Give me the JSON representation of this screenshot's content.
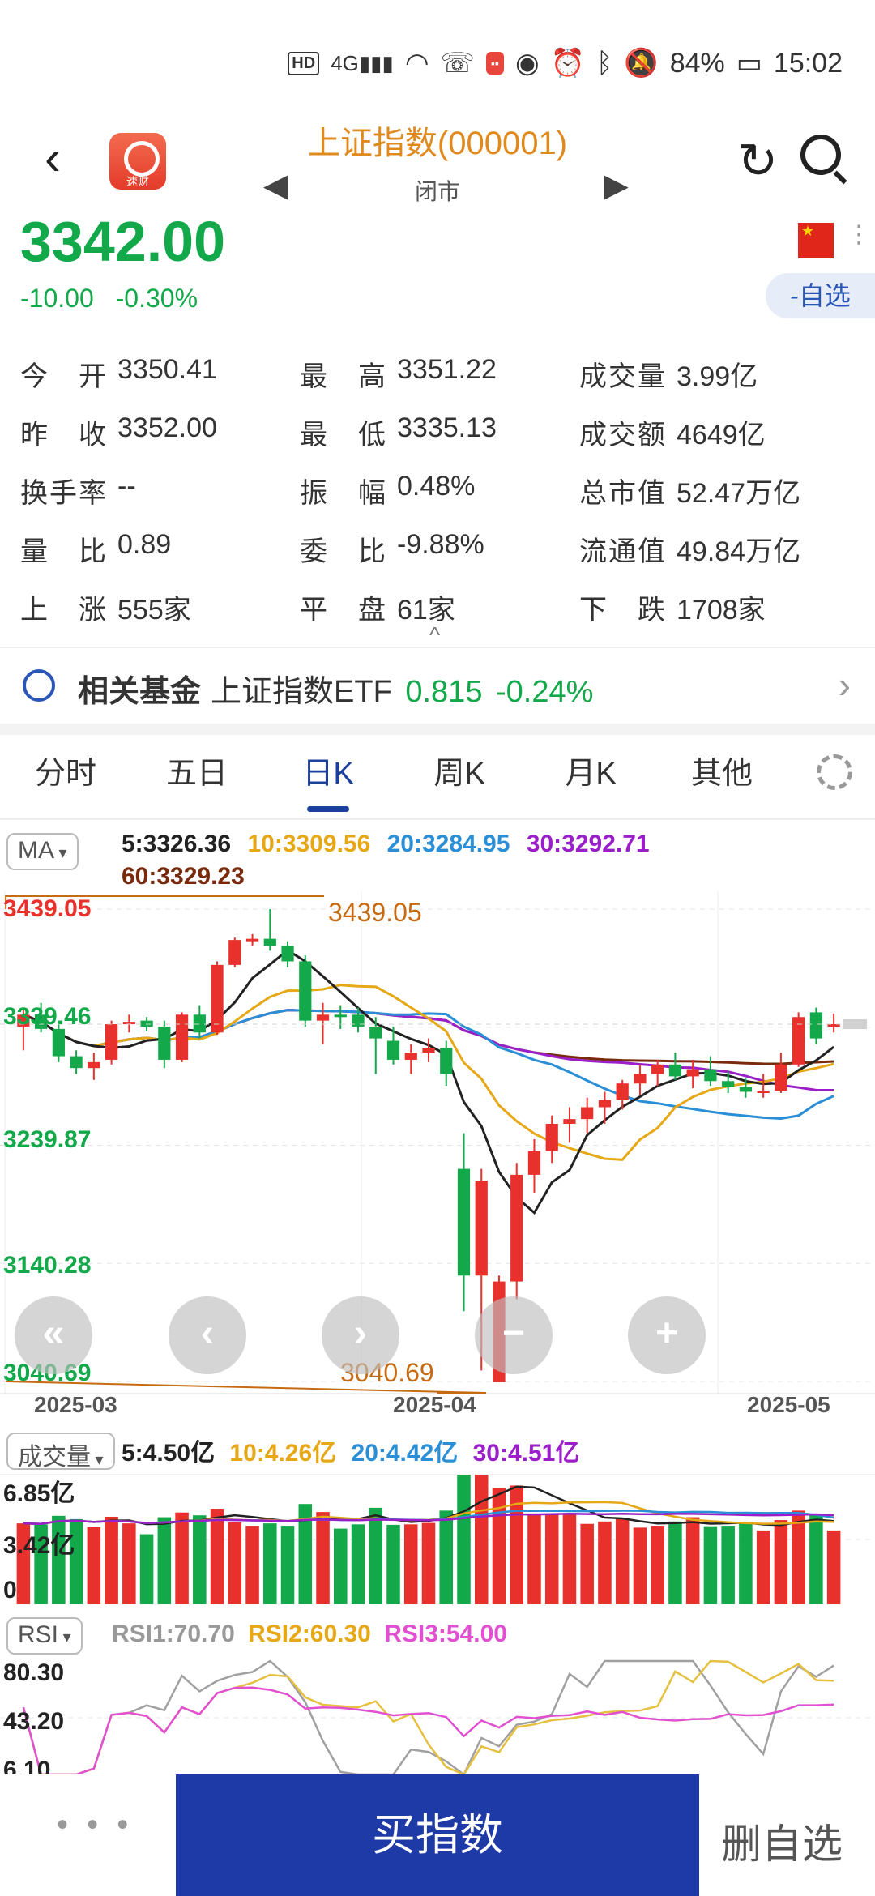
{
  "status_bar": {
    "battery": "84%",
    "time": "15:02",
    "signal": "4G",
    "hd": "HD"
  },
  "header": {
    "title": "上证指数(000001)",
    "market_status": "闭市"
  },
  "quote": {
    "price": "3342.00",
    "change": "-10.00",
    "change_pct": "-0.30%",
    "watch_button": "-自选"
  },
  "stats": [
    [
      {
        "label": "今　开",
        "value": "3350.41"
      },
      {
        "label": "最　高",
        "value": "3351.22"
      },
      {
        "label": "成交量",
        "value": "3.99亿"
      }
    ],
    [
      {
        "label": "昨　收",
        "value": "3352.00"
      },
      {
        "label": "最　低",
        "value": "3335.13"
      },
      {
        "label": "成交额",
        "value": "4649亿"
      }
    ],
    [
      {
        "label": "换手率",
        "value": "--"
      },
      {
        "label": "振　幅",
        "value": "0.48%"
      },
      {
        "label": "总市值",
        "value": "52.47万亿"
      }
    ],
    [
      {
        "label": "量　比",
        "value": "0.89"
      },
      {
        "label": "委　比",
        "value": "-9.88%"
      },
      {
        "label": "流通值",
        "value": "49.84万亿"
      }
    ],
    [
      {
        "label": "上　涨",
        "value": "555家"
      },
      {
        "label": "平　盘",
        "value": "61家"
      },
      {
        "label": "下　跌",
        "value": "1708家"
      }
    ]
  ],
  "fund": {
    "title": "相关基金",
    "name": "上证指数ETF",
    "price": "0.815",
    "change": "-0.24%"
  },
  "tabs": [
    "分时",
    "五日",
    "日K",
    "周K",
    "月K",
    "其他"
  ],
  "active_tab": "日K",
  "ma": {
    "selector": "MA",
    "ma5": "5:3326.36",
    "ma10": "10:3309.56",
    "ma20": "20:3284.95",
    "ma30": "30:3292.71",
    "ma60": "60:3329.23"
  },
  "kline": {
    "y_labels": [
      "3439.05",
      "3339.46",
      "3239.87",
      "3140.28",
      "3040.69"
    ],
    "high_marker": "3439.05",
    "low_marker": "3040.69",
    "x_labels": [
      "2025-03",
      "2025-04",
      "2025-05"
    ]
  },
  "volume": {
    "selector": "成交量",
    "ma5": "5:4.50亿",
    "ma10": "10:4.26亿",
    "ma20": "20:4.42亿",
    "ma30": "30:4.51亿",
    "y_labels": [
      "6.85亿",
      "3.42亿",
      "0"
    ]
  },
  "rsi": {
    "selector": "RSI",
    "rsi1": "RSI1:70.70",
    "rsi2": "RSI2:60.30",
    "rsi3": "RSI3:54.00",
    "y_labels": [
      "80.30",
      "43.20",
      "6.10"
    ]
  },
  "zoom": {
    "back": "«",
    "prev": "‹",
    "next": "›",
    "minus": "−",
    "plus": "+"
  },
  "bottom": {
    "more": "• • •",
    "buy": "买指数",
    "remove": "删自选"
  },
  "colors": {
    "up": "#e8302c",
    "down": "#13a84a",
    "ma5": "#222222",
    "ma10": "#e6a817",
    "ma20": "#2a8fd6",
    "ma30": "#9b1fc9",
    "ma60": "#7a2a0c"
  },
  "chart_data": {
    "type": "candlestick",
    "ylim": [
      3040.69,
      3439.05
    ],
    "candles": [
      [
        3340,
        3355,
        3320,
        3350
      ],
      [
        3350,
        3360,
        3335,
        3338
      ],
      [
        3338,
        3345,
        3310,
        3315
      ],
      [
        3315,
        3320,
        3300,
        3305
      ],
      [
        3305,
        3318,
        3295,
        3310
      ],
      [
        3312,
        3345,
        3308,
        3342
      ],
      [
        3342,
        3350,
        3335,
        3344
      ],
      [
        3345,
        3348,
        3336,
        3340
      ],
      [
        3340,
        3345,
        3305,
        3312
      ],
      [
        3312,
        3352,
        3310,
        3350
      ],
      [
        3350,
        3358,
        3330,
        3335
      ],
      [
        3335,
        3395,
        3333,
        3392
      ],
      [
        3392,
        3415,
        3390,
        3413
      ],
      [
        3413,
        3418,
        3408,
        3414
      ],
      [
        3414,
        3439,
        3404,
        3408
      ],
      [
        3408,
        3412,
        3390,
        3395
      ],
      [
        3395,
        3400,
        3340,
        3345
      ],
      [
        3345,
        3360,
        3325,
        3350
      ],
      [
        3350,
        3358,
        3338,
        3348
      ],
      [
        3350,
        3356,
        3335,
        3340
      ],
      [
        3340,
        3348,
        3300,
        3330
      ],
      [
        3328,
        3340,
        3308,
        3312
      ],
      [
        3312,
        3325,
        3300,
        3318
      ],
      [
        3318,
        3330,
        3310,
        3322
      ],
      [
        3322,
        3328,
        3290,
        3300
      ],
      [
        3220,
        3250,
        3100,
        3130
      ],
      [
        3130,
        3220,
        3050,
        3210
      ],
      [
        3040,
        3130,
        3040,
        3125
      ],
      [
        3125,
        3225,
        3110,
        3215
      ],
      [
        3215,
        3245,
        3200,
        3235
      ],
      [
        3235,
        3265,
        3225,
        3258
      ],
      [
        3258,
        3272,
        3242,
        3262
      ],
      [
        3262,
        3280,
        3250,
        3272
      ],
      [
        3272,
        3285,
        3258,
        3278
      ],
      [
        3278,
        3295,
        3270,
        3292
      ],
      [
        3292,
        3308,
        3282,
        3300
      ],
      [
        3300,
        3312,
        3290,
        3308
      ],
      [
        3308,
        3318,
        3295,
        3298
      ],
      [
        3298,
        3312,
        3288,
        3304
      ],
      [
        3304,
        3315,
        3290,
        3294
      ],
      [
        3294,
        3302,
        3284,
        3289
      ],
      [
        3289,
        3296,
        3280,
        3285
      ],
      [
        3285,
        3300,
        3280,
        3286
      ],
      [
        3286,
        3318,
        3284,
        3308
      ],
      [
        3308,
        3352,
        3306,
        3348
      ],
      [
        3352,
        3356,
        3325,
        3330
      ],
      [
        3340,
        3351,
        3335,
        3342
      ]
    ]
  }
}
